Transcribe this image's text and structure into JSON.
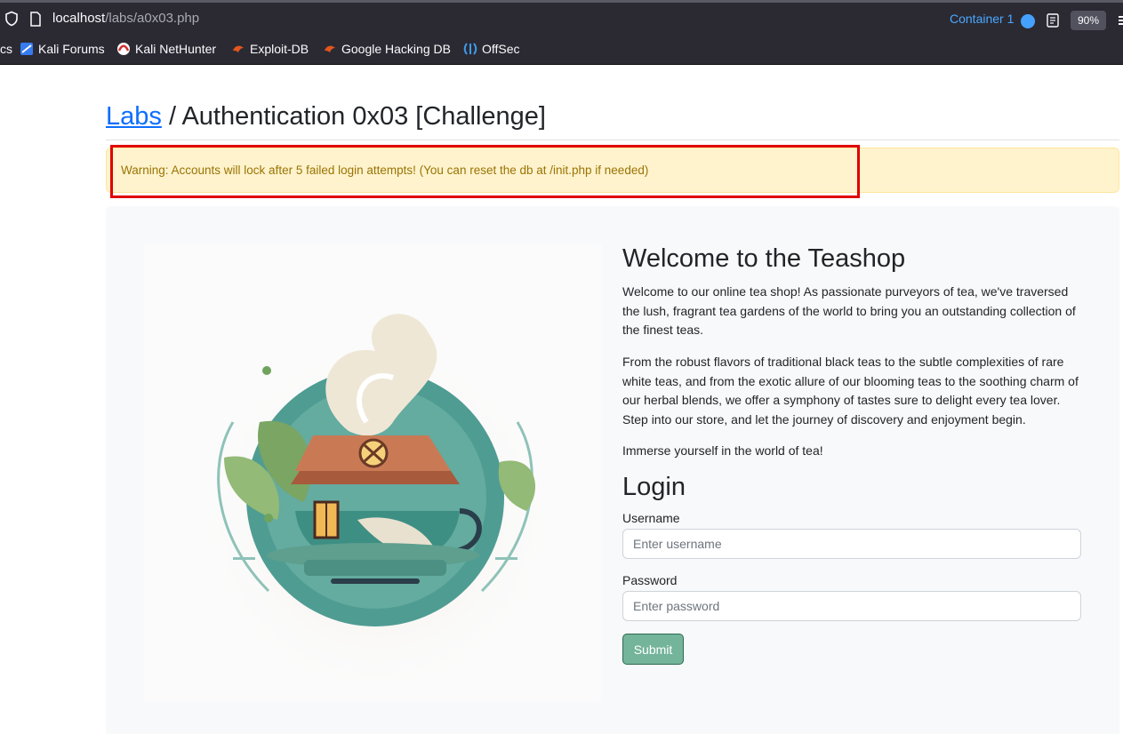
{
  "browser": {
    "url_host": "localhost",
    "url_path": "/labs/a0x03.php",
    "container_label": "Container 1",
    "zoom": "90%"
  },
  "bookmarks": [
    {
      "label": "cs",
      "icon": "bookmark-cs-icon"
    },
    {
      "label": "Kali Forums",
      "icon": "kali-forums-icon"
    },
    {
      "label": "Kali NetHunter",
      "icon": "kali-nethunter-icon"
    },
    {
      "label": "Exploit-DB",
      "icon": "exploit-db-icon"
    },
    {
      "label": "Google Hacking DB",
      "icon": "google-hacking-db-icon"
    },
    {
      "label": "OffSec",
      "icon": "offsec-icon"
    }
  ],
  "page": {
    "breadcrumb_link": "Labs",
    "breadcrumb_rest": " / Authentication 0x03 [Challenge]",
    "warning": "Warning: Accounts will lock after 5 failed login attempts! (You can reset the db at /init.php if needed)",
    "welcome_title": "Welcome to the Teashop",
    "paragraph1": "Welcome to our online tea shop! As passionate purveyors of tea, we've traversed the lush, fragrant tea gardens of the world to bring you an outstanding collection of the finest teas.",
    "paragraph2": "From the robust flavors of traditional black teas to the subtle complexities of rare white teas, and from the exotic allure of our blooming teas to the soothing charm of our herbal blends, we offer a symphony of tastes sure to delight every tea lover. Step into our store, and let the journey of discovery and enjoyment begin.",
    "paragraph3": "Immerse yourself in the world of tea!",
    "login_title": "Login",
    "username_label": "Username",
    "username_placeholder": "Enter username",
    "username_value": "",
    "password_label": "Password",
    "password_placeholder": "Enter password",
    "password_value": "",
    "submit_label": "Submit"
  },
  "colors": {
    "link": "#0d6efd",
    "alert_bg": "#fff3cd",
    "alert_text": "#997404",
    "highlight_box": "#e00000",
    "submit_bg": "#74b49a"
  }
}
